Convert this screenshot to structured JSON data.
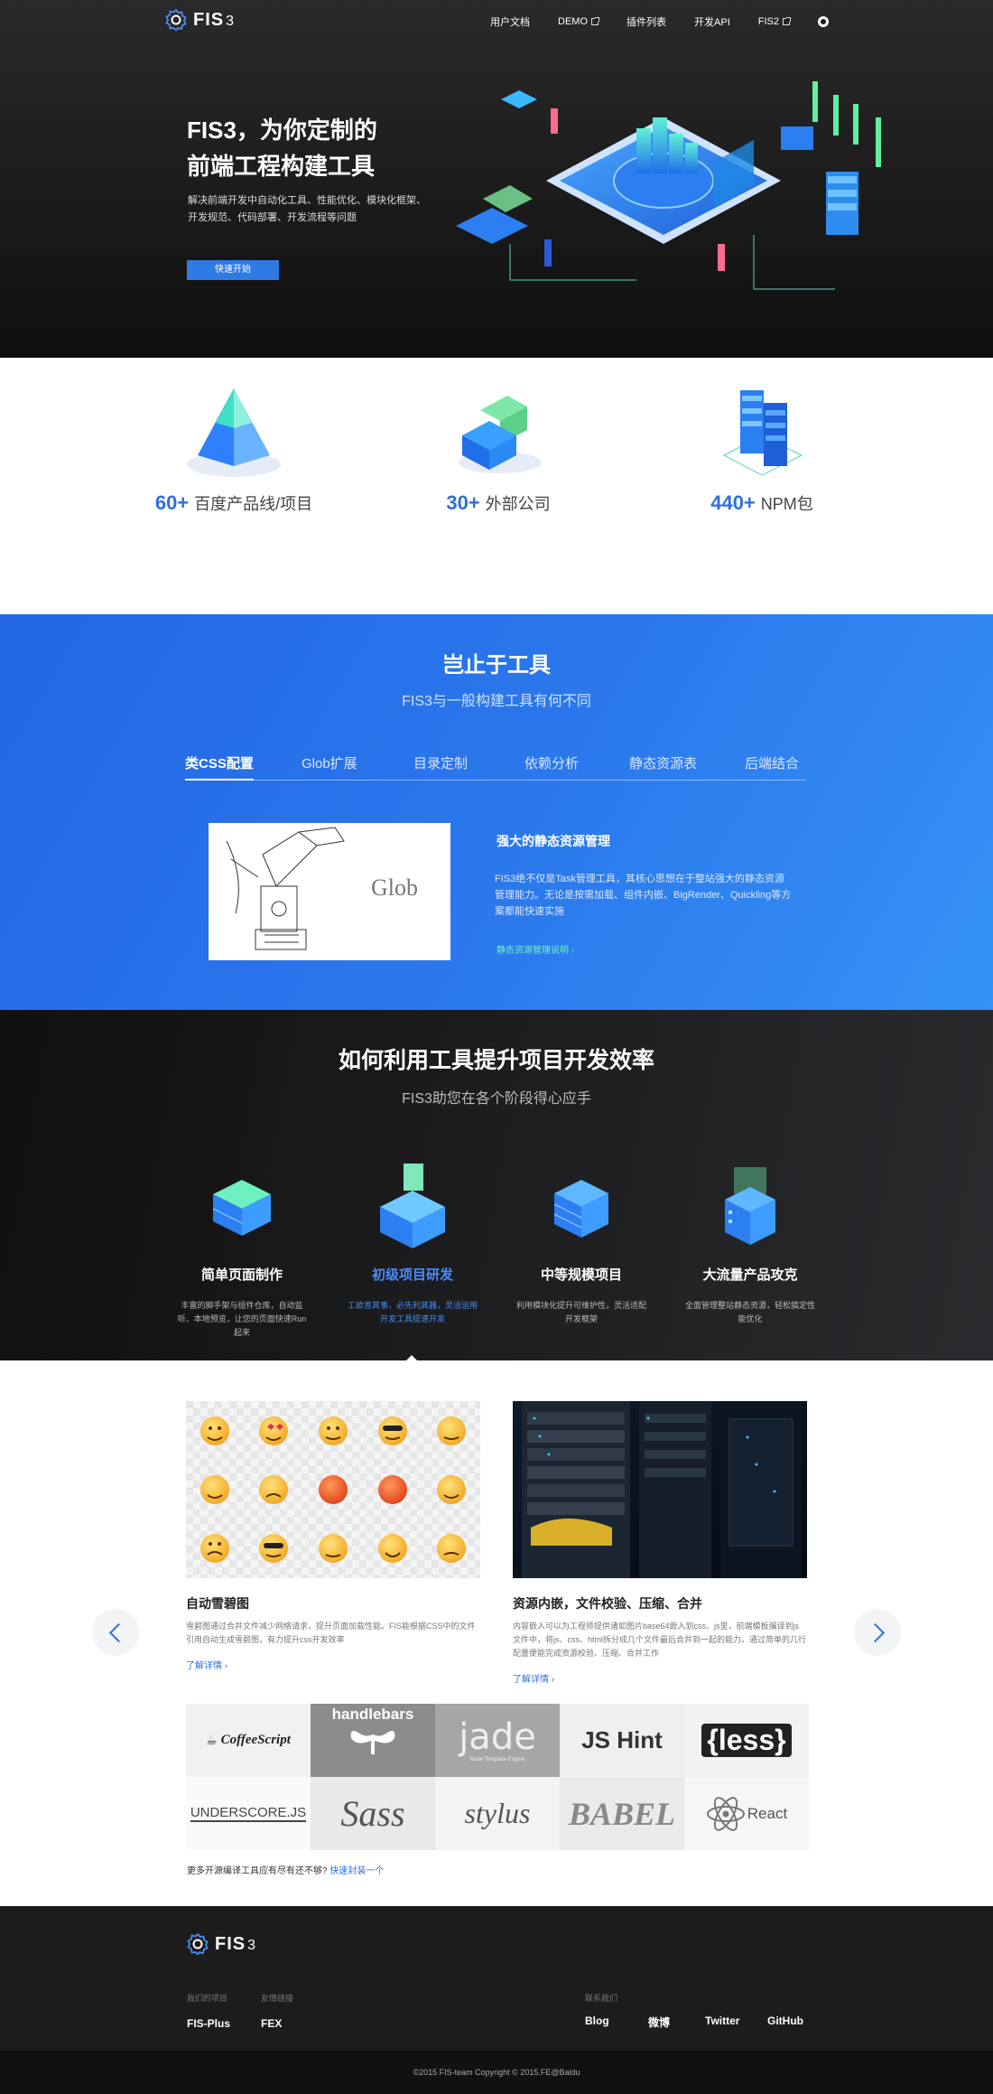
{
  "nav": {
    "logo": "FIS",
    "logo_version": "3",
    "items": [
      {
        "label": "用户文档",
        "external": false
      },
      {
        "label": "DEMO",
        "external": true
      },
      {
        "label": "插件列表",
        "external": false
      },
      {
        "label": "开发API",
        "external": false
      },
      {
        "label": "FIS2",
        "external": true
      }
    ],
    "github_icon": "github-icon"
  },
  "hero": {
    "title_line1": "FIS3，为你定制的",
    "title_line2": "前端工程构建工具",
    "desc": "解决前端开发中自动化工具、性能优化、模块化框架、开发规范、代码部署、开发流程等问题",
    "button": "快速开始"
  },
  "stats": [
    {
      "number": "60+",
      "label": "百度产品线/项目"
    },
    {
      "number": "30+",
      "label": "外部公司"
    },
    {
      "number": "440+",
      "label": "NPM包"
    }
  ],
  "features": {
    "title": "岂止于工具",
    "subtitle": "FIS3与一般构建工具有何不同",
    "tabs": [
      "类CSS配置",
      "Glob扩展",
      "目录定制",
      "依赖分析",
      "静态资源表",
      "后端结合"
    ],
    "active_tab": 0,
    "image_text": "Glob",
    "heading": "强大的静态资源管理",
    "body": "FIS3绝不仅是Task管理工具，其核心思想在于整站强大的静态资源管理能力。无论是按需加载、组件内嵌、BigRender、Quickling等方案都能快速实施",
    "link": "静态资源管理说明"
  },
  "how": {
    "title": "如何利用工具提升项目开发效率",
    "subtitle": "FIS3助您在各个阶段得心应手",
    "stages": [
      {
        "name": "简单页面制作",
        "desc": "丰富的脚手架与组件仓库，自动监听、本地预览，让您的页面快速Run起来"
      },
      {
        "name": "初级项目研发",
        "desc": "工欲善其事，必先利其器，灵活运用开发工具提速开发"
      },
      {
        "name": "中等规模项目",
        "desc": "利用模块化提升可维护性，灵活适配开发框架"
      },
      {
        "name": "大流量产品攻克",
        "desc": "全面管理整站静态资源，轻松搞定性能优化"
      }
    ],
    "active_stage": 1
  },
  "cards": [
    {
      "title": "自动雪碧图",
      "desc": "雪碧图通过合并文件减少网络请求，提升页面加载性能。FIS能根据CSS中的文件引用自动生成雪碧图，有力提升css开发效率",
      "link": "了解详情"
    },
    {
      "title": "资源内嵌，文件校验、压缩、合并",
      "desc": "内容嵌入可以为工程师提供诸如图片base64嵌入到css、js里，前端模板编译到js文件中，将js、css、html拆分成几个文件最后合并到一起的能力。通过简单的几行配置便能完成资源校验、压缩、合并工作",
      "link": "了解详情"
    }
  ],
  "tools": [
    "CoffeeScript",
    "handlebars",
    "jade",
    "Node Template Engine",
    "JS Hint",
    "{less}",
    "UNDERSCORE.JS",
    "Sass",
    "stylus",
    "BABEL",
    "React"
  ],
  "more": {
    "text": "更多开源编译工具应有尽有还不够?",
    "link": "快速封装一个"
  },
  "footer": {
    "logo": "FIS",
    "logo_version": "3",
    "col1_label": "我们的项目",
    "col1_link": "FIS-Plus",
    "col2_label": "友情链接",
    "col2_link": "FEX",
    "col3_label": "联系我们",
    "col3_links": [
      "Blog",
      "微博",
      "Twitter",
      "GitHub"
    ],
    "copyright": "©2015 FIS-team Copyright © 2015.FE@Baidu"
  },
  "colors": {
    "accent": "#2f6fde",
    "feature_bg": "#2b79ec",
    "link_green": "#6ef0c8"
  }
}
